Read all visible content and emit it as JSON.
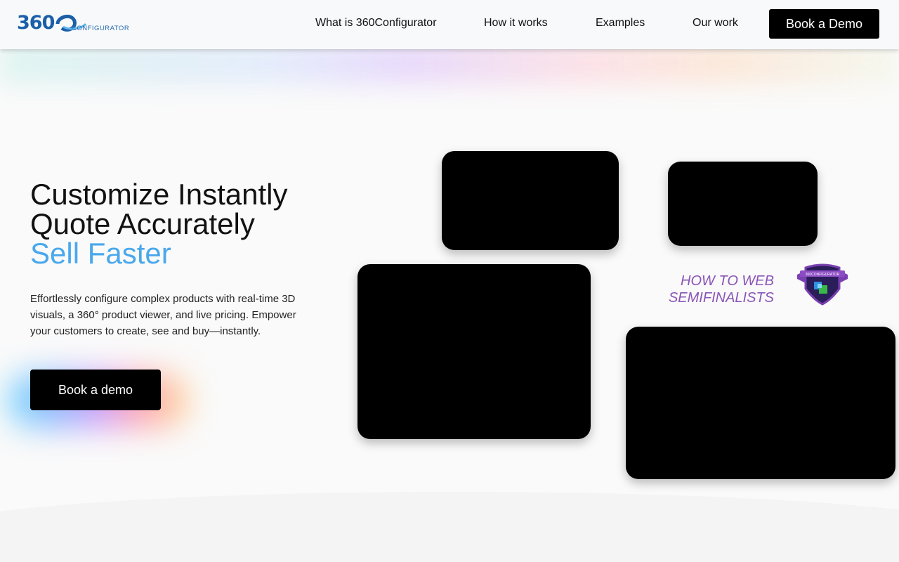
{
  "brand": {
    "logo_number": "360",
    "logo_wordmark": "CONFIGURATOR",
    "badge_text": "360CONFIGURATOR"
  },
  "nav": {
    "links": [
      {
        "label": "What is 360Configurator"
      },
      {
        "label": "How it works"
      },
      {
        "label": "Examples"
      },
      {
        "label": "Our work"
      }
    ],
    "cta_label": "Book a Demo"
  },
  "hero": {
    "title_lines": [
      "Customize Instantly",
      "Quote Accurately",
      "Sell Faster"
    ],
    "description": "Effortlessly configure complex products with real-time 3D visuals, a 360° product viewer, and live pricing. Empower your customers to create, see and buy—instantly.",
    "cta_label": "Book a demo"
  },
  "award": {
    "lines": [
      "HOW TO WEB",
      "SEMIFINALISTS"
    ],
    "icon": "award-badge-icon"
  },
  "media": {
    "tiles": [
      "media-tile",
      "media-tile",
      "media-tile",
      "media-tile"
    ]
  },
  "colors": {
    "accent_blue": "#4aa8ec",
    "brand_blue": "#1a5fa8",
    "award_purple": "#8a55b8",
    "cta_black": "#000000"
  }
}
